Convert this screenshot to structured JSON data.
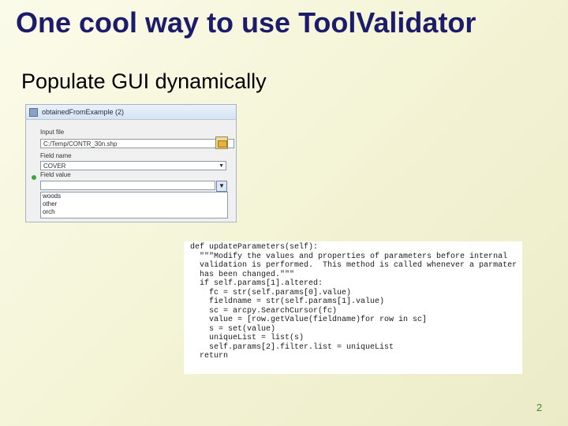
{
  "slide": {
    "title": "One cool way to use ToolValidator",
    "bullet": "Populate GUI dynamically",
    "page_number": "2"
  },
  "dialog": {
    "window_title": "obtainedFromExample (2)",
    "input_file_label": "Input file",
    "input_file_value": "C:/Temp/CONTR_30n.shp",
    "field_name_label": "Field name",
    "field_name_value": "COVER",
    "field_value_label": "Field value",
    "field_value_value": "",
    "list_items": [
      "woods",
      "other",
      "orch"
    ]
  },
  "code": {
    "lines": [
      "def updateParameters(self):",
      "  \"\"\"Modify the values and properties of parameters before internal",
      "  validation is performed.  This method is called whenever a parmater",
      "  has been changed.\"\"\"",
      "",
      "  if self.params[1].altered:",
      "    fc = str(self.params[0].value)",
      "    fieldname = str(self.params[1].value)",
      "    sc = arcpy.SearchCursor(fc)",
      "    value = [row.getValue(fieldname)for row in sc]",
      "    s = set(value)",
      "    uniqueList = list(s)",
      "    self.params[2].filter.list = uniqueList",
      "  return"
    ]
  }
}
